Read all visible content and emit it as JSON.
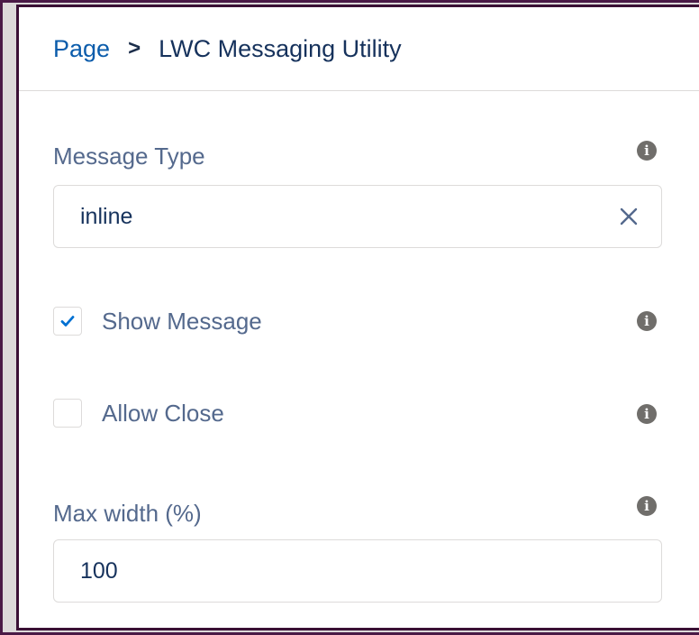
{
  "breadcrumb": {
    "parent": "Page",
    "separator": ">",
    "current": "LWC Messaging Utility"
  },
  "fields": {
    "message_type": {
      "label": "Message Type",
      "value": "inline"
    },
    "show_message": {
      "label": "Show Message",
      "checked": true
    },
    "allow_close": {
      "label": "Allow Close",
      "checked": false
    },
    "max_width": {
      "label": "Max width (%)",
      "value": "100"
    }
  },
  "icons": {
    "info": "info-icon",
    "clear": "close-icon",
    "check": "checkmark-icon"
  },
  "colors": {
    "link": "#0b5cab",
    "label": "#54698d",
    "text": "#16325c",
    "check": "#0070d2",
    "info_icon": "#706e6b",
    "frame_border": "#4a1a46"
  }
}
